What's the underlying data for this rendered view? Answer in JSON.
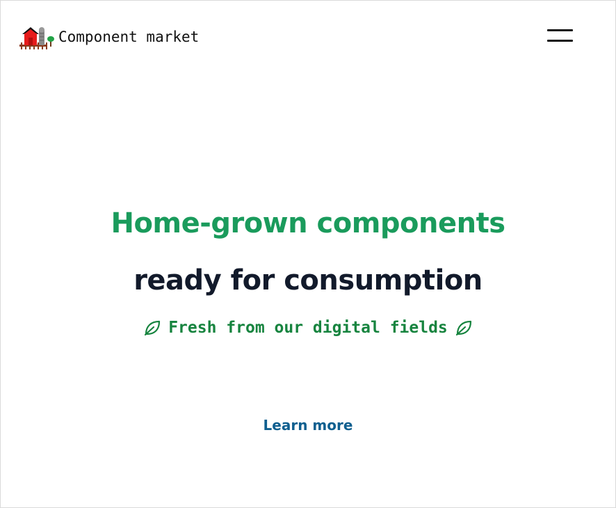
{
  "header": {
    "brand_name": "Component market",
    "logo_icon": "farm-barn-icon",
    "menu_icon": "hamburger-menu-icon"
  },
  "hero": {
    "headline_line1": "Home-grown components",
    "headline_line2": "ready for consumption",
    "tagline": "Fresh from our digital fields",
    "tagline_icon": "leaf-icon",
    "cta_label": "Learn more"
  },
  "colors": {
    "headline_green": "#1a9b5c",
    "headline_dark": "#121a2b",
    "tagline_green": "#17843f",
    "link_blue": "#0f5f8f"
  }
}
